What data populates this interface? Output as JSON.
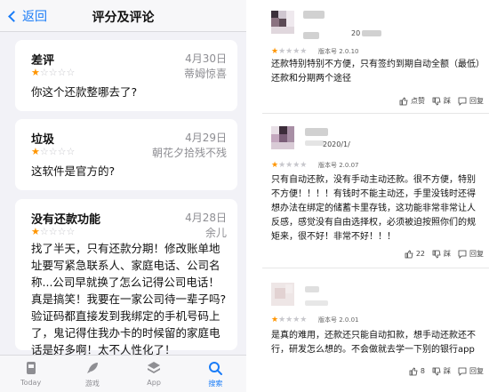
{
  "ios": {
    "back_label": "返回",
    "title": "评分及评论",
    "reviews": [
      {
        "title": "差评",
        "date": "4月30日",
        "user": "蒂姆惊喜",
        "rating": 1,
        "body": "你这个还款整哪去了?"
      },
      {
        "title": "垃圾",
        "date": "4月29日",
        "user": "朝花夕拾残不残",
        "rating": 1,
        "body": "这软件是官方的?"
      },
      {
        "title": "没有还款功能",
        "date": "4月28日",
        "user": "余儿",
        "rating": 1,
        "body": "找了半天，只有还款分期！修改账单地址要写紧急联系人、家庭电话、公司名称...公司早就换了怎么记得公司电话！真是搞笑！我要在一家公司待一辈子吗? 验证码都直接发到我绑定的手机号码上了，鬼记得住我办卡的时候留的家庭电话是好多啊！太不人性化了！"
      }
    ],
    "tabs": [
      {
        "label": "Today",
        "icon": "today-icon"
      },
      {
        "label": "游戏",
        "icon": "rocket-icon"
      },
      {
        "label": "App",
        "icon": "app-stack-icon"
      },
      {
        "label": "搜索",
        "icon": "search-icon",
        "active": true
      }
    ],
    "accent": "#1a7cf7",
    "star_color": "#ff9500"
  },
  "android": {
    "comments": [
      {
        "version": "版本号 2.0.10",
        "date_partial": "20",
        "rating": 1,
        "body": "还款特别特别不方便，只有签约到期自动全额（最低）还款和分期两个途径",
        "like_label": "点赞",
        "dislike_label": "踩",
        "reply_label": "回复"
      },
      {
        "version": "版本号 2.0.07",
        "date_partial": "2020/1/",
        "rating": 1,
        "body": "只有自动还款，没有手动主动还款。很不方便，特别不方便！！！！有钱时不能主动还，手里没钱时还得想办法在绑定的储蓄卡里存钱，这功能非常非常让人反感，感觉没有自由选择权，必须被迫按照你们的规矩来，很不好！非常不好！！！",
        "like_count": "22",
        "dislike_label": "踩",
        "reply_label": "回复"
      },
      {
        "version": "版本号 2.0.01",
        "date_partial": "",
        "rating": 1,
        "body": "是真的难用，还款还只能自动扣款，想手动还款还不行，研发怎么想的。不会做就去学一下别的银行app",
        "like_count": "8",
        "dislike_label": "踩",
        "reply_label": "回复"
      }
    ],
    "star_color": "#ff9500"
  }
}
